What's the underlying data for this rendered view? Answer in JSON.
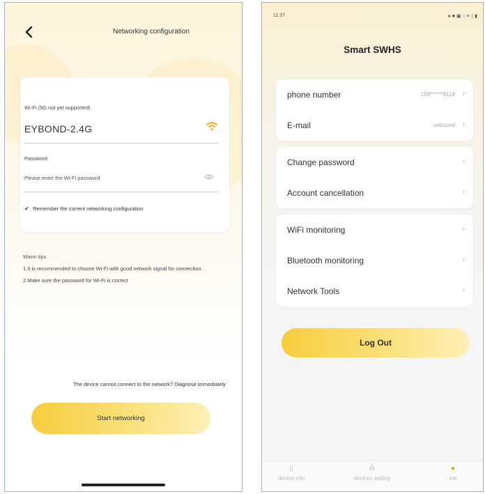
{
  "left": {
    "title": "Networking configuration",
    "wifi_label": "Wi-Fi (5G not yet supported)",
    "ssid": "EYBOND-2.4G",
    "password_label": "Password",
    "password_placeholder": "Please enter the Wi-Fi password",
    "remember": "Remember the current networking configuration",
    "tips_title": "Warm tips",
    "tip1": "1.It is recommended to choose Wi-Fi with good network signal for connection.",
    "tip2": "2.Make sure the password for Wi-Fi is correct",
    "diagnose": "The device cannot connect to the network? Diagnose immediately",
    "start_button": "Start networking",
    "accent": "#f6c93a"
  },
  "right": {
    "status_time": "11:37",
    "status_icons": "● ■ ▣ ○ ≡ ∣ ▮",
    "title": "Smart SWHS",
    "group1": [
      {
        "label": "phone number",
        "value": "159******8114"
      },
      {
        "label": "E-mail",
        "value": "unbound"
      }
    ],
    "group2": [
      {
        "label": "Change password"
      },
      {
        "label": "Account cancellation"
      }
    ],
    "group3": [
      {
        "label": "WiFi monitoring"
      },
      {
        "label": "Bluetooth monitoring"
      },
      {
        "label": "Network Tools"
      }
    ],
    "logout": "Log Out",
    "tabs": [
      {
        "label": "device info",
        "icon": "phone-icon"
      },
      {
        "label": "devices setting",
        "icon": "sliders-icon"
      },
      {
        "label": "me",
        "icon": "person-icon"
      }
    ],
    "active_tab_color": "#d9a514"
  }
}
